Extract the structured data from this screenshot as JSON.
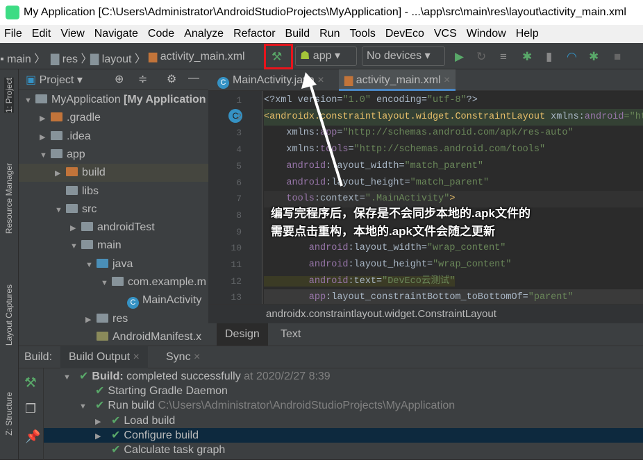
{
  "window": {
    "title": "My Application [C:\\Users\\Administrator\\AndroidStudioProjects\\MyApplication] - ...\\app\\src\\main\\res\\layout\\activity_main.xml"
  },
  "menu": [
    "File",
    "Edit",
    "View",
    "Navigate",
    "Code",
    "Analyze",
    "Refactor",
    "Build",
    "Run",
    "Tools",
    "DevEco",
    "VCS",
    "Window",
    "Help"
  ],
  "toolbar": {
    "breadcrumbs": [
      "main",
      "res",
      "layout",
      "activity_main.xml"
    ],
    "config": "app",
    "device": "No devices",
    "highlight_color": "#e8141c"
  },
  "sidestrip": {
    "project": "1: Project",
    "resource": "Resource Manager",
    "captures": "Layout Captures",
    "structure": "Z: Structure"
  },
  "project": {
    "title": "Project",
    "tree": [
      {
        "label": "MyApplication",
        "bold": " [My Application",
        "depth": 0,
        "arrow": "open",
        "icon": "module"
      },
      {
        "label": ".gradle",
        "depth": 1,
        "arrow": "closed",
        "icon": "orange"
      },
      {
        "label": ".idea",
        "depth": 1,
        "arrow": "closed",
        "icon": "gray"
      },
      {
        "label": "app",
        "depth": 1,
        "arrow": "open",
        "icon": "module"
      },
      {
        "label": "build",
        "depth": 2,
        "arrow": "closed",
        "icon": "orange"
      },
      {
        "label": "libs",
        "depth": 2,
        "arrow": "none",
        "icon": "gray"
      },
      {
        "label": "src",
        "depth": 2,
        "arrow": "open",
        "icon": "gray"
      },
      {
        "label": "androidTest",
        "depth": 3,
        "arrow": "closed",
        "icon": "gray"
      },
      {
        "label": "main",
        "depth": 3,
        "arrow": "open",
        "icon": "gray"
      },
      {
        "label": "java",
        "depth": 4,
        "arrow": "open",
        "icon": "blue"
      },
      {
        "label": "com.example.m",
        "depth": 5,
        "arrow": "open",
        "icon": "gray"
      },
      {
        "label": "MainActivity",
        "depth": 6,
        "arrow": "none",
        "icon": "class"
      },
      {
        "label": "res",
        "depth": 4,
        "arrow": "closed",
        "icon": "gray"
      },
      {
        "label": "AndroidManifest.x",
        "depth": 4,
        "arrow": "none",
        "icon": "manifest"
      }
    ]
  },
  "editor": {
    "tabs": [
      {
        "label": "MainActivity.java",
        "active": false
      },
      {
        "label": "activity_main.xml",
        "active": true
      }
    ],
    "lines": [
      [
        [
          "<?xml version=",
          "t-txt"
        ],
        [
          "\"1.0\"",
          "t-val"
        ],
        [
          " encoding=",
          "t-txt"
        ],
        [
          "\"utf-8\"",
          "t-val"
        ],
        [
          "?>",
          "t-txt"
        ]
      ],
      [
        [
          "<androidx.constraintlayout.widget.ConstraintLayout",
          "t-tag"
        ],
        [
          " xmlns:",
          "t-txt"
        ],
        [
          "android",
          "t-ns"
        ],
        [
          "=\"htt",
          "t-val"
        ]
      ],
      [
        [
          "    xmlns:",
          "t-txt"
        ],
        [
          "app",
          "t-ns"
        ],
        [
          "=",
          "t-txt"
        ],
        [
          "\"http://schemas.android.com/apk/res-auto\"",
          "t-val"
        ]
      ],
      [
        [
          "    xmlns:",
          "t-txt"
        ],
        [
          "tools",
          "t-ns"
        ],
        [
          "=",
          "t-txt"
        ],
        [
          "\"http://schemas.android.com/tools\"",
          "t-val"
        ]
      ],
      [
        [
          "    android",
          "t-ns"
        ],
        [
          ":layout_width=",
          "t-txt"
        ],
        [
          "\"match_parent\"",
          "t-val"
        ]
      ],
      [
        [
          "    android",
          "t-ns"
        ],
        [
          ":layout_height=",
          "t-txt"
        ],
        [
          "\"match_parent\"",
          "t-val"
        ]
      ],
      [
        [
          "    tools",
          "t-ns"
        ],
        [
          ":context=",
          "t-txt"
        ],
        [
          "\".MainActivity\"",
          "t-val"
        ],
        [
          ">",
          "t-tag"
        ]
      ],
      [],
      [],
      [
        [
          "        android",
          "t-ns"
        ],
        [
          ":layout_width=",
          "t-txt"
        ],
        [
          "\"wrap_content\"",
          "t-val"
        ]
      ],
      [
        [
          "        android",
          "t-ns"
        ],
        [
          ":layout_height=",
          "t-txt"
        ],
        [
          "\"wrap_content\"",
          "t-val"
        ]
      ],
      [
        [
          "        android",
          "t-ns"
        ],
        [
          ":text=",
          "t-txt"
        ],
        [
          "\"DevEco云测试\"",
          "t-val"
        ]
      ],
      [
        [
          "        app",
          "t-ns"
        ],
        [
          ":layout_constraintBottom_toBottomOf=",
          "t-txt"
        ],
        [
          "\"parent\"",
          "t-val"
        ]
      ]
    ],
    "breadcrumb": "androidx.constraintlayout.widget.ConstraintLayout",
    "bottom_tabs": [
      "Design",
      "Text"
    ]
  },
  "annotation": [
    "编写完程序后，保存是不会同步本地的.apk文件的",
    "需要点击重构，本地的.apk文件会随之更新"
  ],
  "build": {
    "label": "Build:",
    "tabs": [
      "Build Output",
      "Sync"
    ],
    "rows": [
      {
        "depth": 0,
        "arrow": "open",
        "bold": "Build:",
        "text": " completed successfully",
        "gray": " at 2020/2/27 8:39"
      },
      {
        "depth": 1,
        "arrow": "none",
        "text": "Starting Gradle Daemon"
      },
      {
        "depth": 1,
        "arrow": "open",
        "text": "Run build",
        "gray": " C:\\Users\\Administrator\\AndroidStudioProjects\\MyApplication"
      },
      {
        "depth": 2,
        "arrow": "closed",
        "text": "Load build"
      },
      {
        "depth": 2,
        "arrow": "closed",
        "text": "Configure build",
        "selected": true
      },
      {
        "depth": 2,
        "arrow": "none",
        "text": "Calculate task graph"
      }
    ]
  }
}
